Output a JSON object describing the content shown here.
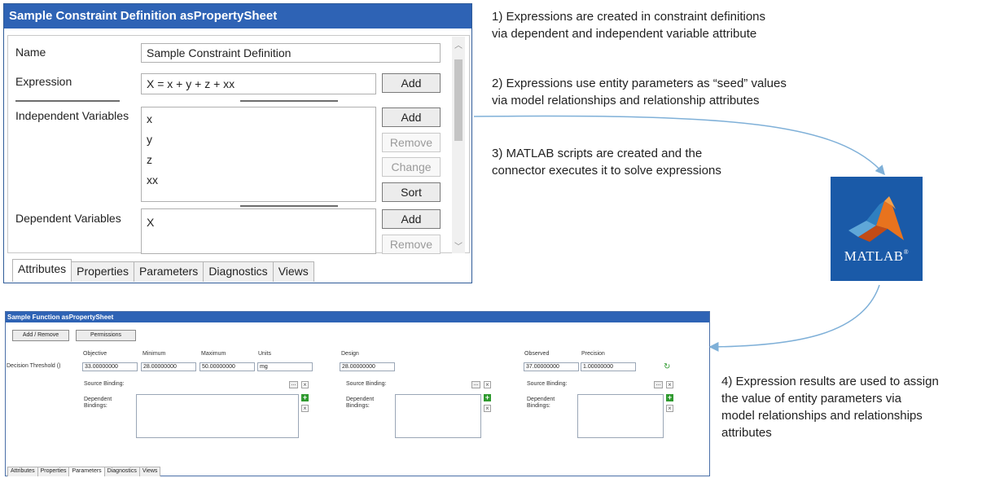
{
  "constraint_sheet": {
    "title": "Sample Constraint Definition asPropertySheet",
    "name_label": "Name",
    "name_value": "Sample Constraint Definition",
    "expression_label": "Expression",
    "expression_value": "X = x + y + z + xx",
    "independent_label": "Independent Variables",
    "independent_vars": [
      "x",
      "y",
      "z",
      "xx"
    ],
    "dependent_label": "Dependent Variables",
    "dependent_vars": [
      "X"
    ],
    "buttons": {
      "add": "Add",
      "remove": "Remove",
      "change": "Change",
      "sort": "Sort"
    },
    "tabs": [
      "Attributes",
      "Properties",
      "Parameters",
      "Diagnostics",
      "Views"
    ],
    "active_tab": "Attributes"
  },
  "function_sheet": {
    "title": "Sample Function asPropertySheet",
    "buttons": [
      "Add / Remove",
      "Permissions"
    ],
    "row_label": "Decision Threshold ()",
    "columns": {
      "objective": "Objective",
      "minimum": "Minimum",
      "maximum": "Maximum",
      "units": "Units",
      "design": "Design",
      "observed": "Observed",
      "precision": "Precision"
    },
    "values": {
      "objective": "33.00000000",
      "minimum": "28.00000000",
      "maximum": "50.00000000",
      "units": "mg",
      "design": "28.00000000",
      "observed": "37.00000000",
      "precision": "1.00000000"
    },
    "source_binding_label": "Source Binding:",
    "dependent_bindings_label1": "Dependent",
    "dependent_bindings_label2": "Bindings:",
    "tabs": [
      "Attributes",
      "Properties",
      "Parameters",
      "Diagnostics",
      "Views"
    ],
    "active_tab": "Parameters"
  },
  "notes": {
    "n1_line1": "1) Expressions are created in constraint definitions",
    "n1_line2": "via dependent and independent variable attribute",
    "n2_line1": "2) Expressions use entity parameters as “seed” values",
    "n2_line2": "via model relationships and relationship attributes",
    "n3_line1": "3) MATLAB scripts are created and the",
    "n3_line2": "connector executes it to solve expressions",
    "n4_line1": "4) Expression results are used to assign",
    "n4_line2": "the value of entity parameters via",
    "n4_line3": "model relationships and relationships",
    "n4_line4": "attributes"
  },
  "logo": {
    "text": "MATLAB",
    "registered": "®",
    "colors": {
      "bg": "#1a5aa8",
      "peak": "#e8731e"
    }
  },
  "colors": {
    "title_bar": "#2e63b5",
    "arrow": "#7fb0d8"
  }
}
